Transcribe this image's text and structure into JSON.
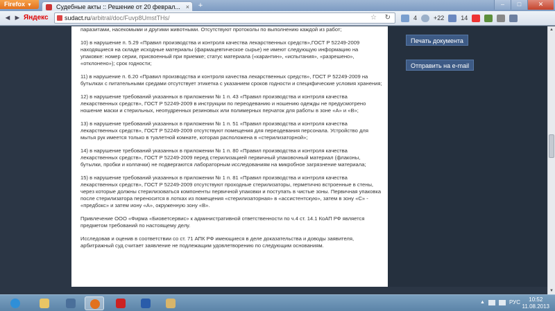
{
  "browser": {
    "menu_label": "Firefox",
    "tab_title": "Судебные акты :: Решение от 20 феврал...",
    "tab_close": "×",
    "new_tab": "+",
    "win_minimize": "–",
    "win_maximize": "□",
    "win_close": "✕",
    "back": "◄",
    "forward": "►",
    "search_brand": "Яндекс",
    "url_host": "sudact.ru",
    "url_path": "/arbitral/doc/Fuvp8UmstTHs/",
    "star": "☆",
    "reload": "↻",
    "mail_count": "4",
    "weather": "+22",
    "notif_count": "14"
  },
  "document": {
    "paragraphs": [
      "паразитами, насекомыми и другими животными. Отсутствуют протоколы по выполнению каждой из работ;",
      "10) в нарушение п. 5.29 «Правил производства и контроля качества лекарственных средств»,ГОСТ Р 52249-2009 находящиеся на складе исходные материалы (фармацевтическое сырье) не имеют следующую информацию на упаковке: номер серии, присвоенный при приемке; статус материала («карантин», «испытания», «разрешено», «отклонено»); срок годности;",
      "11) в нарушение п. 6.20 «Правил производства и контроля качества лекарственных средств», ГОСТ Р 52249-2009 на бутылках с питательными средами отсутствует этикетка с указанием сроков годности и специфические условия хранения;",
      "12) в нарушение требований указанных в приложении № 1 п. 43 «Правил производства и контроля качества лекарственных средств», ГОСТ Р 52249-2009 в инструкции по переодеванию и ношению одежды не предусмотрено ношение маски и стерильных, неопудренных резиновых или полимерных перчаток для работы в зоне «А» и «В»;",
      "13) в нарушение требований указанных в приложении № 1 п. 51 «Правил производства и контроля качества лекарственных средств», ГОСТ Р 52249-2009 отсутствуют помещения для переодевания персонала. Устройство для мытья рук имеется только в туалетной комнате, которая расположена в «стерилизаторной»;",
      "14) в нарушение требований указанных в приложении № 1 п. 80 «Правил производства и контроля качества лекарственных средств», ГОСТ Р 52249-2009 перед стерилизацией первичный упаковочный материал (флаконы, бутылки, пробки и колпачки) не подвергаются лабораторным исследованиям на микробное загрязнение материала;",
      "15) в нарушение требований указанных в приложении № 1 п. 81 «Правил производства и контроля качества лекарственных средств», ГОСТ Р 52249-2009 отсутствуют проходные стерилизаторы, герметично встроенные в стены, через которые должны стерилизоваться компоненты первичной упаковки и поступать в чистые зоны. Первичная упаковка после стерилизатора переносится в лотках из помещения «стерилизаторная» в «ассистентскую», затем в зону «С» - «предбокс» и затем иону «А», окруженную зону «В».",
      "Привлечение ООО «Фирма «Биоветсервис» к административной ответственности по ч.4 ст. 14.1 КоАП РФ является предметом требований по настоящему делу.",
      "Исследовав и оценив в соответствии со ст. 71 АПК РФ имеющиеся в деле доказательства и доводы заявителя, арбитражный суд считает заявление не подлежащим удовлетворению по следующим основаниям."
    ]
  },
  "sidebar": {
    "print_label": "Печать документа",
    "email_label": "Отправить на e-mail"
  },
  "taskbar": {
    "tray_lang": "РУС",
    "tray_up": "▲",
    "clock_time": "10:52",
    "clock_date": "11.08.2013"
  },
  "colors": {
    "page_bg": "#2b3645",
    "button": "#3d5a85",
    "firefox_orange": "#e2711d"
  }
}
